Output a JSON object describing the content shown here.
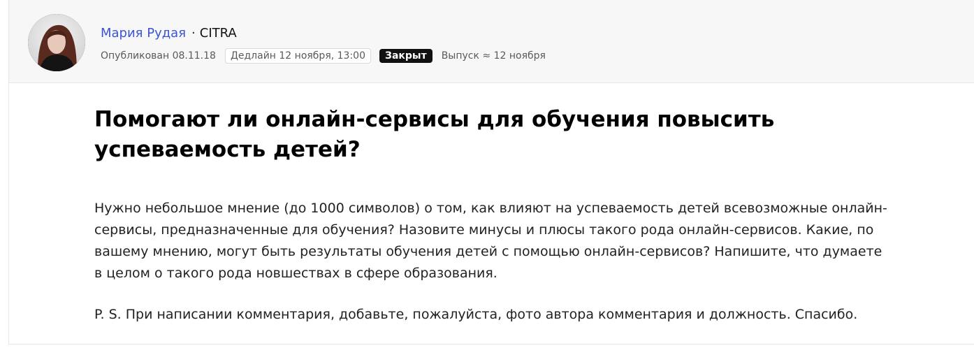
{
  "author": {
    "name": "Мария Рудая",
    "separator": "·",
    "company": "CITRA"
  },
  "meta": {
    "published": "Опубликован 08.11.18",
    "deadline": "Дедлайн 12 ноября, 13:00",
    "status": "Закрыт",
    "release": "Выпуск ≈ 12 ноября"
  },
  "post": {
    "title": "Помогают ли онлайн-сервисы для обучения повысить успеваемость детей?",
    "body": "Нужно небольшое мнение (до 1000 символов) о том, как влияют на успеваемость детей всевозможные онлайн-сервисы, предназначенные для обучения? Назовите минусы и плюсы такого рода онлайн-сервисов. Какие, по вашему мнению, могут быть результаты обучения детей с помощью онлайн-сервисов? Напишите, что думаете в целом о такого рода новшествах в сфере образования.",
    "ps": "P. S. При написании комментария, добавьте, пожалуйста, фото автора комментария и должность. Спасибо."
  }
}
